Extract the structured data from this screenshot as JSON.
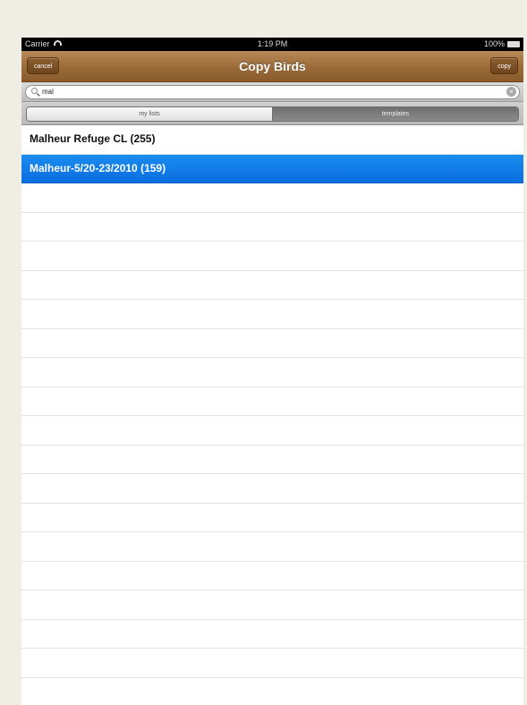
{
  "status_bar": {
    "carrier": "Carrier",
    "time": "1:19 PM",
    "battery": "100%"
  },
  "nav_bar": {
    "title": "Copy Birds",
    "cancel_label": "cancel",
    "copy_label": "copy"
  },
  "search": {
    "value": "mal"
  },
  "segments": {
    "my_lists": "my lists",
    "templates": "templates",
    "selected": "templates"
  },
  "list": {
    "items": [
      {
        "label": "Malheur Refuge CL (255)",
        "selected": false
      },
      {
        "label": "Malheur-5/20-23/2010 (159)",
        "selected": true
      }
    ]
  },
  "colors": {
    "nav_bar": "#9a6a38",
    "selection": "#1b8df0"
  }
}
